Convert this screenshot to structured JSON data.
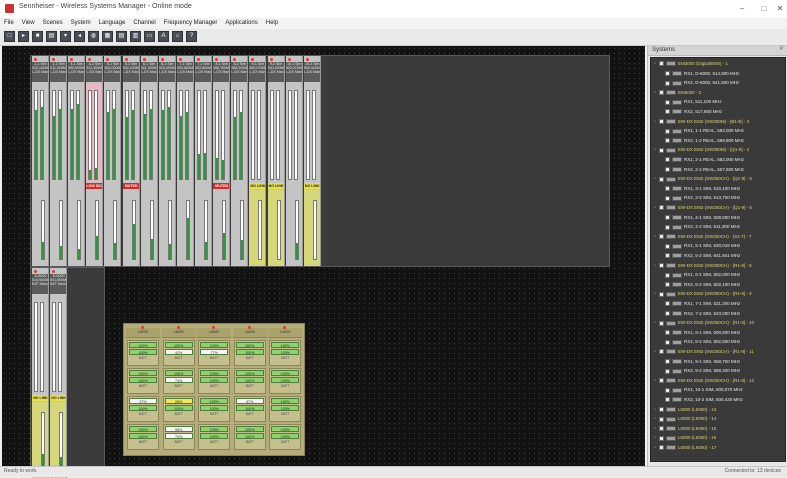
{
  "window": {
    "title": "Sennheiser - Wireless Systems Manager - Online mode",
    "minimize": "–",
    "maximize": "□",
    "close": "✕"
  },
  "menu": [
    "File",
    "View",
    "Scenes",
    "System",
    "Language",
    "Channel",
    "Frequency Manager",
    "Applications",
    "Help"
  ],
  "toolbar_icons": [
    "new-icon",
    "open-icon",
    "save-icon",
    "print-icon",
    "scan-icon",
    "mute-icon",
    "monitor-icon",
    "grid-icon",
    "list-icon",
    "rack-icon",
    "chart-icon",
    "text-icon",
    "network-icon",
    "help-icon"
  ],
  "right_panel": {
    "title": "Systems",
    "pin": "#",
    "tree": [
      {
        "type": "sys",
        "label": "EM3000 (Digital6000) - 1"
      },
      {
        "type": "dev",
        "label": "RX1, D-6000, 514,900 MHz"
      },
      {
        "type": "dev",
        "label": "RX2, D-6000, 541,600 MHz"
      },
      {
        "type": "sys",
        "label": "EM6000 - 2"
      },
      {
        "type": "dev",
        "label": "RX1, 511,100 MHz"
      },
      {
        "type": "dev",
        "label": "RX2, 517,800 MHz"
      },
      {
        "type": "sys",
        "label": "EW-DX EM2 (SW300M) - [B1-B] - 3"
      },
      {
        "type": "dev",
        "label": "RX1, 1-1 REAL, 562,000 MHz"
      },
      {
        "type": "dev",
        "label": "RX2, 1-2 REAL, 569,900 MHz"
      },
      {
        "type": "sys",
        "label": "EW-DX EM2 (SW300M) - [Q1-9] - 4"
      },
      {
        "type": "dev",
        "label": "RX1, 2-1 REAL, 562,000 MHz"
      },
      {
        "type": "dev",
        "label": "RX2, 2-2 REAL, 567,500 MHz"
      },
      {
        "type": "sys",
        "label": "EW-DX EM2 (SW300CH) - [Q1-9] - 5"
      },
      {
        "type": "dev",
        "label": "RX1, 3-1 SIM, 510,100 MHz"
      },
      {
        "type": "dev",
        "label": "RX2, 3-2 SIM, 513,700 MHz"
      },
      {
        "type": "sys",
        "label": "EW-DX EM2 (SW300CH) - [Q1-9] - 6"
      },
      {
        "type": "dev",
        "label": "RX1, 4-1 SIM, 509,000 MHz"
      },
      {
        "type": "dev",
        "label": "RX2, 4-2 SIM, 511,300 MHz"
      },
      {
        "type": "sys",
        "label": "EW-DX EM2 (SW300CH) - [S2-7] - 7"
      },
      {
        "type": "dev",
        "label": "RX1, 5-1 SIM, 630,016 MHz"
      },
      {
        "type": "dev",
        "label": "RX2, 5-2 SIM, 641,941 MHz"
      },
      {
        "type": "sys",
        "label": "EW-DX EM2 (SW300CH) - [R1-9] - 8"
      },
      {
        "type": "dev",
        "label": "RX1, 6-1 SIM, 502,000 MHz"
      },
      {
        "type": "dev",
        "label": "RX2, 6-2 SIM, 502,100 MHz"
      },
      {
        "type": "sys",
        "label": "EW-DX EM2 (SW300CH) - [R1-9] - 9"
      },
      {
        "type": "dev",
        "label": "RX1, 7-1 SIM, 521,300 MHz"
      },
      {
        "type": "dev",
        "label": "RX2, 7-2 SIM, 523,000 MHz"
      },
      {
        "type": "sys",
        "label": "EW-DX EM2 (SW300CH) - [R1-9] - 10"
      },
      {
        "type": "dev",
        "label": "RX1, 8-1 SIM, 500,800 MHz"
      },
      {
        "type": "dev",
        "label": "RX2, 8-2 SIM, 502,800 MHz"
      },
      {
        "type": "sys",
        "label": "EW-DX EM2 (SW300CH) - [R1-9] - 11"
      },
      {
        "type": "dev",
        "label": "RX1, 9-1 SIM, 558,700 MHz"
      },
      {
        "type": "dev",
        "label": "RX2, 9-2 SIM, 568,200 MHz"
      },
      {
        "type": "sys",
        "label": "EW-DX EM2 (SW300CH) - [R1-9] - 12"
      },
      {
        "type": "dev",
        "label": "RX1, 10-1 SIM, 500,070 MHz"
      },
      {
        "type": "dev",
        "label": "RX2, 10-2 SIM, 500,420 MHz"
      },
      {
        "type": "sys",
        "label": "L6000 (L6000) - 13"
      },
      {
        "type": "sys",
        "label": "L6000 (L6000) - 14"
      },
      {
        "type": "sys",
        "label": "L6000 (L6000) - 15"
      },
      {
        "type": "sys",
        "label": "L6000 (L6000) - 16"
      },
      {
        "type": "sys",
        "label": "L6000 (L6000) - 17"
      }
    ]
  },
  "channels_top": [
    {
      "name": "1-1 Sim",
      "freq": "510,100MHz",
      "mode": "L-DX Manual",
      "meter": 78,
      "meter2": 82,
      "low": 30,
      "state": "",
      "pink": false,
      "yellow": false
    },
    {
      "name": "1-2 Sim",
      "freq": "511,300MHz",
      "mode": "L-DX Manual",
      "meter": 72,
      "meter2": 80,
      "low": 22,
      "state": "",
      "pink": false,
      "yellow": false
    },
    {
      "name": "4-1 Sim",
      "freq": "509,000MHz",
      "mode": "L-DX Manual",
      "meter": 80,
      "meter2": 85,
      "low": 18,
      "state": "",
      "pink": false,
      "yellow": false
    },
    {
      "name": "4-2 Sim",
      "freq": "511,300MHz",
      "mode": "L-DX Manual",
      "meter": 10,
      "meter2": 12,
      "low": 40,
      "state": "LOW SIGNAL",
      "pink": true,
      "yellow": false
    },
    {
      "name": "5-1 Sim",
      "freq": "502,000MHz",
      "mode": "L-DX Manual",
      "meter": 76,
      "meter2": 80,
      "low": 28,
      "state": "",
      "pink": false,
      "yellow": false
    },
    {
      "name": "6-2 Sim",
      "freq": "502,100MHz",
      "mode": "L-DX Manual",
      "meter": 70,
      "meter2": 78,
      "low": 60,
      "state": "MUTED",
      "pink": false,
      "yellow": false
    },
    {
      "name": "6-1 Sim",
      "freq": "521,300MHz",
      "mode": "L-DX Manual",
      "meter": 74,
      "meter2": 80,
      "low": 34,
      "state": "",
      "pink": false,
      "yellow": false
    },
    {
      "name": "6-2 Sim",
      "freq": "523,000MHz",
      "mode": "L-DX Manual",
      "meter": 78,
      "meter2": 82,
      "low": 26,
      "state": "",
      "pink": false,
      "yellow": false
    },
    {
      "name": "7-1 Sim",
      "freq": "500,800MHz",
      "mode": "L-DX Manual",
      "meter": 72,
      "meter2": 76,
      "low": 70,
      "state": "",
      "pink": false,
      "yellow": false
    },
    {
      "name": "7-2 Sim",
      "freq": "502,800MHz",
      "mode": "L-DX Manual",
      "meter": 28,
      "meter2": 30,
      "low": 30,
      "state": "",
      "pink": false,
      "yellow": false
    },
    {
      "name": "8-1 Sim",
      "freq": "558,700MHz",
      "mode": "L-DX Manual",
      "meter": 24,
      "meter2": 22,
      "low": 44,
      "state": "MUTED",
      "pink": false,
      "yellow": false
    },
    {
      "name": "8-2 Sim",
      "freq": "568,200MHz",
      "mode": "L-DX Manual",
      "meter": 70,
      "meter2": 76,
      "low": 32,
      "state": "",
      "pink": false,
      "yellow": false
    },
    {
      "name": "9-1 Sim",
      "freq": "500,070MHz",
      "mode": "L-DX Manual",
      "meter": 0,
      "meter2": 0,
      "low": 0,
      "state": "NO LINK",
      "pink": false,
      "yellow": true
    },
    {
      "name": "9-2 Sim",
      "freq": "500,420MHz",
      "mode": "L-DX Manual",
      "meter": 0,
      "meter2": 0,
      "low": 0,
      "state": "NO LINK",
      "pink": false,
      "yellow": true
    },
    {
      "name": "10-1 Sim",
      "freq": "500,070MHz",
      "mode": "L-DX Manual",
      "meter": 0,
      "meter2": 0,
      "low": 28,
      "state": "",
      "pink": false,
      "yellow": false
    },
    {
      "name": "10-2 Sim",
      "freq": "500,420MHz",
      "mode": "L-DX Manual",
      "meter": 0,
      "meter2": 0,
      "low": 0,
      "state": "NO LINK",
      "pink": false,
      "yellow": true
    }
  ],
  "channels_bottom": [
    {
      "name": "D-6000",
      "freq": "514,900MHz",
      "mode": "B1F Manual",
      "meter": 0,
      "meter2": 0,
      "low": 30,
      "state": "NO LINK",
      "pink": false,
      "yellow": true
    },
    {
      "name": "D-6000",
      "freq": "541,600MHz",
      "mode": "B1F Manual",
      "meter": 0,
      "meter2": 0,
      "low": 24,
      "state": "NO LINK",
      "pink": false,
      "yellow": true
    }
  ],
  "chargers": [
    {
      "name": "L6000",
      "cells": [
        [
          "100%",
          "100%"
        ],
        [
          "100%",
          "100%"
        ],
        [
          "97%",
          "100%"
        ],
        [
          "100%",
          "100%"
        ]
      ]
    },
    {
      "name": "L6000",
      "cells": [
        [
          "100%",
          "42%"
        ],
        [
          "100%",
          "73%"
        ],
        [
          "28%",
          "100%"
        ],
        [
          "98%",
          "70%"
        ]
      ]
    },
    {
      "name": "L6000",
      "cells": [
        [
          "100%",
          "77%"
        ],
        [
          "100%",
          "100%"
        ],
        [
          "100%",
          "100%"
        ],
        [
          "100%",
          "100%"
        ]
      ]
    },
    {
      "name": "L6000",
      "cells": [
        [
          "100%",
          "100%"
        ],
        [
          "100%",
          "100%"
        ],
        [
          "97%",
          "100%"
        ],
        [
          "100%",
          "100%"
        ]
      ]
    },
    {
      "name": "L6000",
      "cells": [
        [
          "100%",
          "100%"
        ],
        [
          "100%",
          "100%"
        ],
        [
          "100%",
          "100%"
        ],
        [
          "100%",
          "100%"
        ]
      ]
    }
  ],
  "charger_footer": "BATT",
  "status": {
    "left": "Ready to work.",
    "right": "Connected to: 13 devices"
  }
}
